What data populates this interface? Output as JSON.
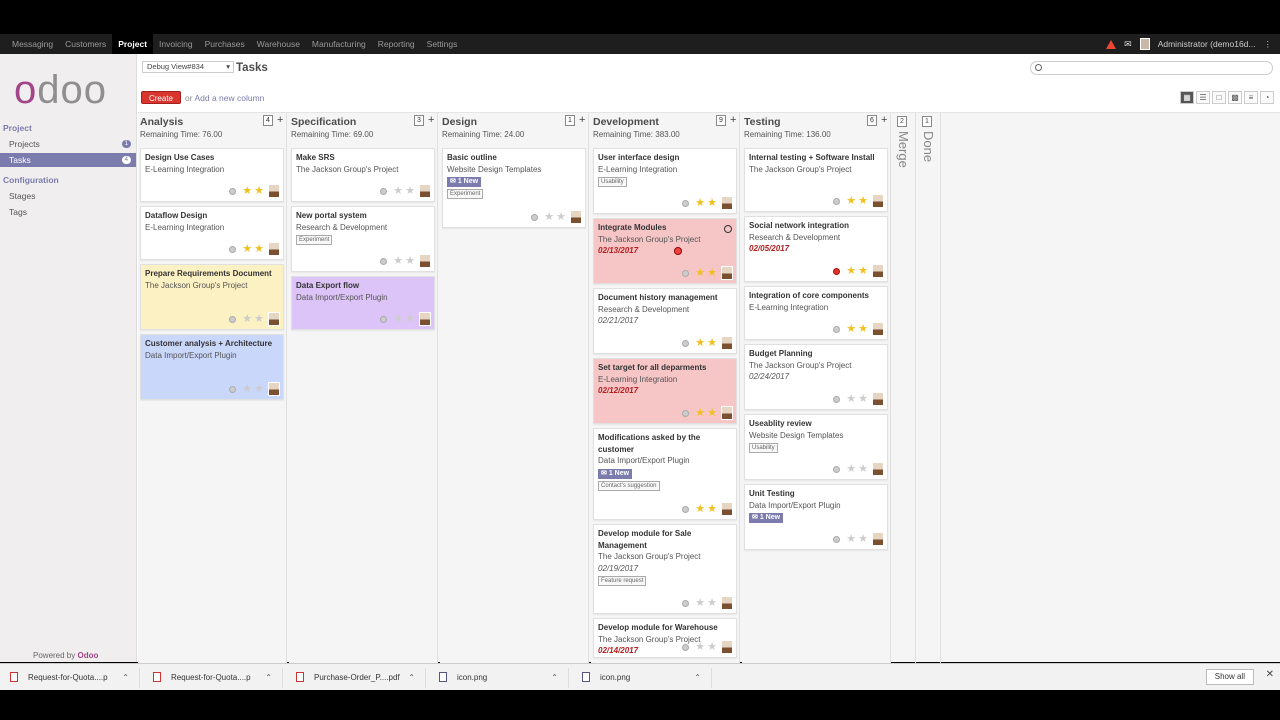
{
  "topmenu": [
    "Messaging",
    "Customers",
    "Project",
    "Invoicing",
    "Purchases",
    "Warehouse",
    "Manufacturing",
    "Reporting",
    "Settings"
  ],
  "topmenu_active": "Project",
  "user_label": "Administrator (demo16d...",
  "sidebar": {
    "section_project": "Project",
    "projects": "Projects",
    "projects_badge": "1",
    "tasks": "Tasks",
    "tasks_badge": "4",
    "section_config": "Configuration",
    "stages": "Stages",
    "tags": "Tags",
    "powered_prefix": "Powered by ",
    "powered_brand": "Odoo"
  },
  "header": {
    "debug": "Debug View#834",
    "title": "Tasks",
    "create": "Create",
    "or": "or",
    "add_column": "Add a new column"
  },
  "columns": [
    {
      "name": "Analysis",
      "remaining": "Remaining Time: 76.00",
      "count": "4",
      "cards": [
        {
          "title": "Design Use Cases",
          "project": "E-Learning Integration",
          "color": "white",
          "stars": 2,
          "h": 54
        },
        {
          "title": "Dataflow Design",
          "project": "E-Learning Integration",
          "color": "white",
          "stars": 2,
          "h": 54
        },
        {
          "title": "Prepare Requirements Document",
          "project": "The Jackson Group's Project",
          "color": "yellow",
          "stars": 0,
          "h": 66
        },
        {
          "title": "Customer analysis + Architecture",
          "project": "Data Import/Export Plugin",
          "color": "blue",
          "stars": 0,
          "h": 66
        }
      ]
    },
    {
      "name": "Specification",
      "remaining": "Remaining Time: 69.00",
      "count": "3",
      "cards": [
        {
          "title": "Make SRS",
          "project": "The Jackson Group's Project",
          "color": "white",
          "stars": 0,
          "h": 54
        },
        {
          "title": "New portal system",
          "project": "Research & Development",
          "tag": "Experiment",
          "color": "white",
          "stars": 0,
          "h": 66
        },
        {
          "title": "Data Export flow",
          "project": "Data Import/Export Plugin",
          "color": "purple",
          "stars": 0,
          "h": 54
        }
      ]
    },
    {
      "name": "Design",
      "remaining": "Remaining Time: 24.00",
      "count": "1",
      "cards": [
        {
          "title": "Basic outline",
          "project": "Website Design Templates",
          "newmsg": "1 New",
          "tag": "Experiment",
          "color": "white",
          "stars": 0,
          "h": 80
        }
      ]
    },
    {
      "name": "Development",
      "remaining": "Remaining Time: 383.00",
      "count": "9",
      "cards": [
        {
          "title": "User interface design",
          "project": "E-Learning Integration",
          "tag": "Usability",
          "color": "white",
          "stars": 2,
          "h": 66
        },
        {
          "title": "Integrate Modules",
          "project": "The Jackson Group's Project",
          "date": "02/13/2017",
          "late": true,
          "color": "red",
          "stars": 2,
          "h": 66
        },
        {
          "title": "Document history management",
          "project": "Research & Development",
          "date": "02/21/2017",
          "color": "white",
          "stars": 2,
          "h": 66
        },
        {
          "title": "Set target for all deparments",
          "project": "E-Learning Integration",
          "date": "02/12/2017",
          "late": true,
          "color": "red",
          "stars": 2,
          "h": 66
        },
        {
          "title": "Modifications asked by the customer",
          "project": "Data Import/Export Plugin",
          "newmsg": "1 New",
          "tag": "Contact's suggestion",
          "color": "white",
          "stars": 2,
          "h": 92
        },
        {
          "title": "Develop module for Sale Management",
          "project": "The Jackson Group's Project",
          "date": "02/19/2017",
          "tag": "Feature request",
          "color": "white",
          "stars": 0,
          "h": 90
        },
        {
          "title": "Develop module for Warehouse",
          "project": "The Jackson Group's Project",
          "date": "02/14/2017",
          "late": true,
          "color": "white",
          "stars": 0,
          "h": 40
        }
      ]
    },
    {
      "name": "Testing",
      "remaining": "Remaining Time: 136.00",
      "count": "6",
      "cards": [
        {
          "title": "Internal testing + Software Install",
          "project": "The Jackson Group's Project",
          "color": "white",
          "stars": 2,
          "h": 64
        },
        {
          "title": "Social network integration",
          "project": "Research & Development",
          "date": "02/05/2017",
          "late": true,
          "color": "white",
          "stars": 2,
          "reddot": true,
          "h": 66
        },
        {
          "title": "Integration of core components",
          "project": "E-Learning Integration",
          "color": "white",
          "stars": 2,
          "h": 54
        },
        {
          "title": "Budget Planning",
          "project": "The Jackson Group's Project",
          "date": "02/24/2017",
          "color": "white",
          "stars": 0,
          "h": 66
        },
        {
          "title": "Useablity review",
          "project": "Website Design Templates",
          "tag": "Usability",
          "color": "white",
          "stars": 0,
          "h": 66
        },
        {
          "title": "Unit Testing",
          "project": "Data Import/Export Plugin",
          "newmsg": "1 New",
          "color": "white",
          "stars": 0,
          "h": 66
        }
      ]
    }
  ],
  "folded": [
    {
      "name": "Merge",
      "count": "2"
    },
    {
      "name": "Done",
      "count": "1"
    }
  ],
  "downloads": [
    {
      "name": "Request-for-Quota....p",
      "type": "pdf"
    },
    {
      "name": "Request-for-Quota....p",
      "type": "pdf"
    },
    {
      "name": "Purchase-Order_P....pdf",
      "type": "pdf"
    },
    {
      "name": "icon.png",
      "type": "img"
    },
    {
      "name": "icon.png",
      "type": "img"
    }
  ],
  "show_all": "Show all",
  "colors": {
    "accent": "#7c7bad",
    "brand": "#a24689",
    "create": "#d9342e",
    "late": "#b32020"
  }
}
